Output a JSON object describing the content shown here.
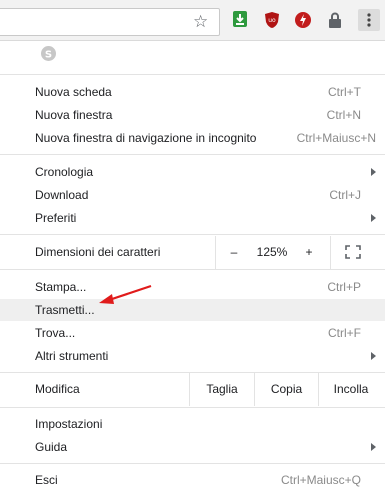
{
  "menu": {
    "new_tab": {
      "label": "Nuova scheda",
      "shortcut": "Ctrl+T"
    },
    "new_window": {
      "label": "Nuova finestra",
      "shortcut": "Ctrl+N"
    },
    "incognito": {
      "label": "Nuova finestra di navigazione in incognito",
      "shortcut": "Ctrl+Maiusc+N"
    },
    "history": {
      "label": "Cronologia"
    },
    "downloads": {
      "label": "Download",
      "shortcut": "Ctrl+J"
    },
    "bookmarks": {
      "label": "Preferiti"
    },
    "zoom": {
      "label": "Dimensioni dei caratteri",
      "minus": "–",
      "value": "125%",
      "plus": "+"
    },
    "print": {
      "label": "Stampa...",
      "shortcut": "Ctrl+P"
    },
    "cast": {
      "label": "Trasmetti..."
    },
    "find": {
      "label": "Trova...",
      "shortcut": "Ctrl+F"
    },
    "more_tools": {
      "label": "Altri strumenti"
    },
    "edit": {
      "label": "Modifica",
      "cut": "Taglia",
      "copy": "Copia",
      "paste": "Incolla"
    },
    "settings": {
      "label": "Impostazioni"
    },
    "help": {
      "label": "Guida"
    },
    "exit": {
      "label": "Esci",
      "shortcut": "Ctrl+Maiusc+Q"
    }
  },
  "icons": {
    "bookmark_star": "star-icon",
    "extension1": "green-download-extension-icon",
    "extension2": "ublock-origin-icon",
    "extension3": "flash-extension-icon",
    "extension4": "padlock-icon",
    "menu": "three-dot-menu-icon",
    "profile": "skype-icon",
    "fullscreen": "fullscreen-icon",
    "annotation": "red-arrow"
  },
  "colors": {
    "highlight": "#efefef",
    "arrow": "#e01b1b",
    "ublock": "#b01414"
  }
}
